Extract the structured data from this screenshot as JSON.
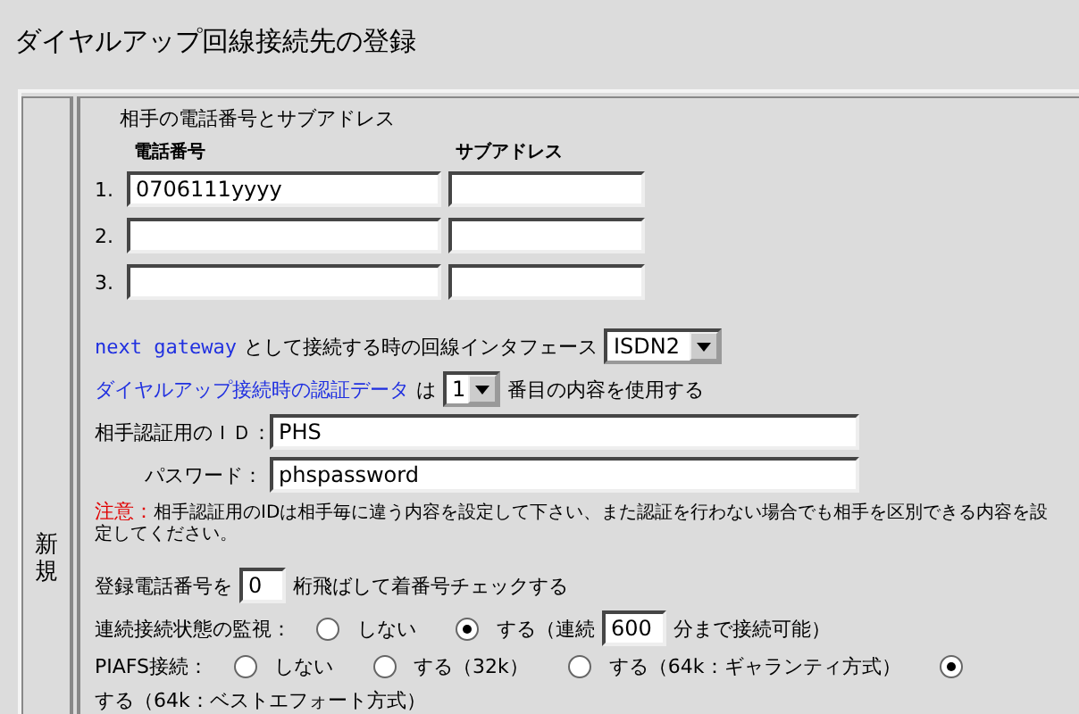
{
  "title": "ダイヤルアップ回線接続先の登録",
  "side_label": "新規",
  "phone_section": {
    "heading": "相手の電話番号とサブアドレス",
    "phone_column": "電話番号",
    "subaddress_column": "サブアドレス",
    "rows": [
      {
        "number": "1.",
        "phone": "0706111yyyy",
        "subaddress": ""
      },
      {
        "number": "2.",
        "phone": "",
        "subaddress": ""
      },
      {
        "number": "3.",
        "phone": "",
        "subaddress": ""
      }
    ]
  },
  "gateway": {
    "link": "next gateway",
    "text": "として接続する時の回線インタフェース",
    "value": "ISDN2"
  },
  "auth_data": {
    "link": "ダイヤルアップ接続時の認証データ",
    "text": "は",
    "value": "1",
    "suffix": "番目の内容を使用する"
  },
  "auth_id": {
    "label": "相手認証用のＩＤ：",
    "value": "PHS"
  },
  "password": {
    "label": "パスワード：",
    "value": "phspassword"
  },
  "notice": {
    "label": "注意：",
    "text": "相手認証用のIDは相手毎に違う内容を設定して下さい、また認証を行わない場合でも相手を区別できる内容を設定してください。"
  },
  "skip_digits": {
    "prefix": "登録電話番号を",
    "value": "0",
    "suffix": "桁飛ばして着番号チェックする"
  },
  "monitor": {
    "label": "連続接続状態の監視：",
    "options": [
      {
        "label": "しない",
        "selected": false
      },
      {
        "label": "する（連続",
        "selected": true
      }
    ],
    "minutes": "600",
    "suffix": "分まで接続可能）"
  },
  "piafs": {
    "label": "PIAFS接続：",
    "options": [
      {
        "label": "しない",
        "selected": false
      },
      {
        "label": "する（32k）",
        "selected": false
      },
      {
        "label": "する（64k：ギャランティ方式）",
        "selected": false
      },
      {
        "label": "する（64k：ベストエフォート方式）",
        "selected": true
      }
    ]
  }
}
